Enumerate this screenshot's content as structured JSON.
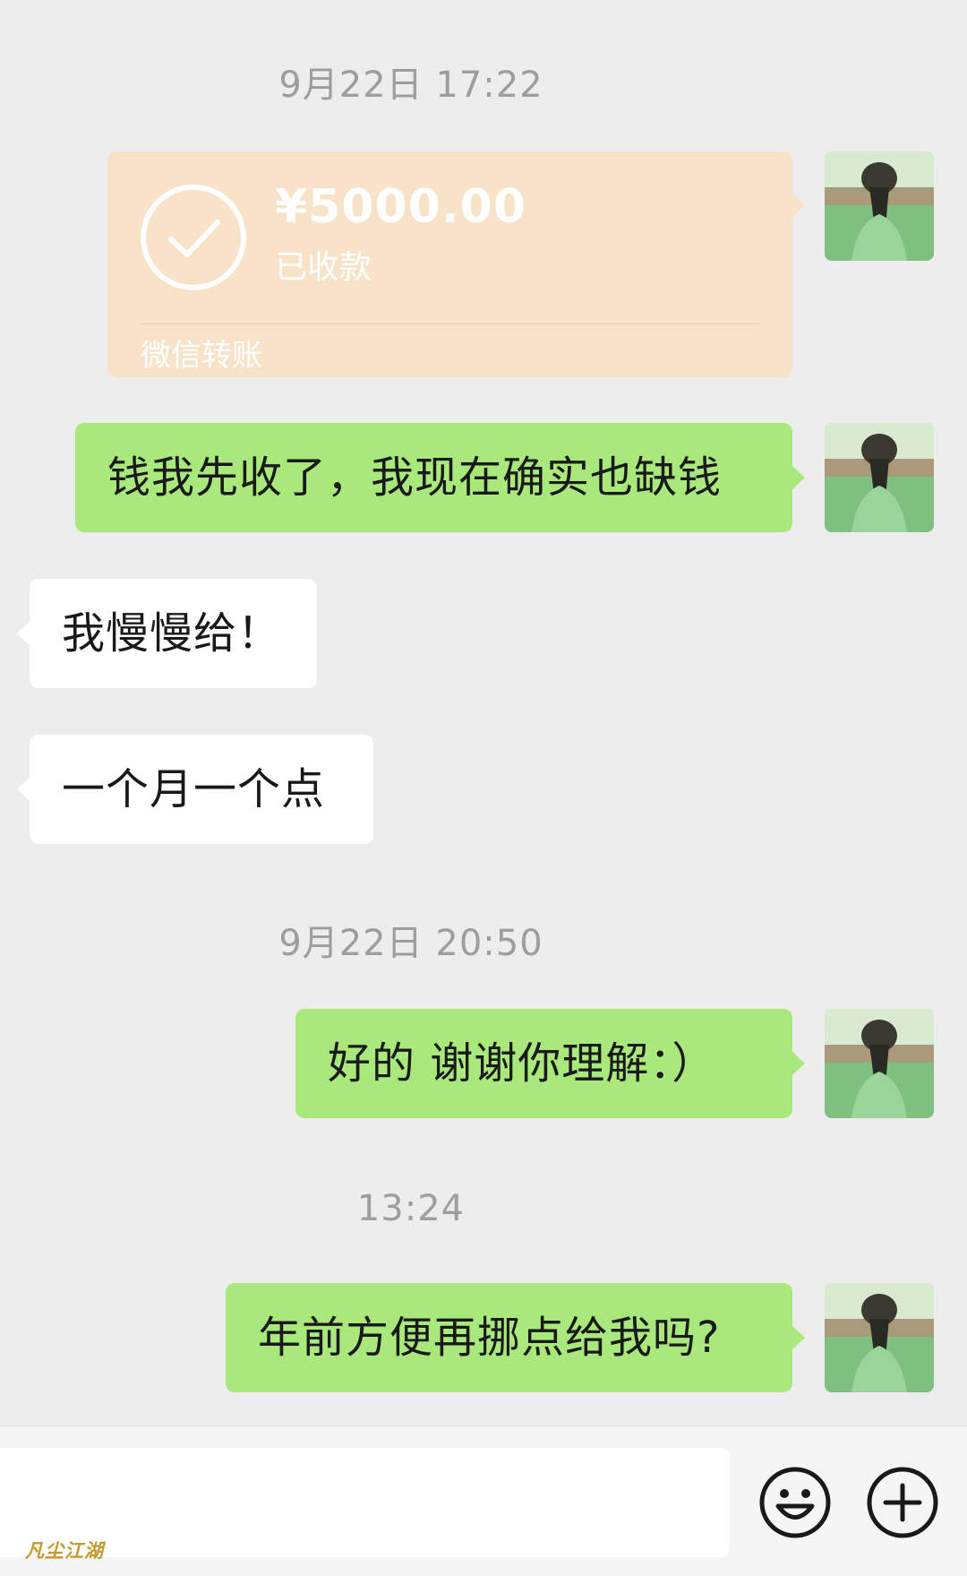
{
  "messages": {
    "timestamp_1": "9月22日 17:22",
    "transfer": {
      "amount": "¥5000.00",
      "status": "已收款",
      "footer": "微信转账"
    },
    "msg_1": "钱我先收了，我现在确实也缺钱",
    "msg_2": "我慢慢给！",
    "msg_3": "一个月一个点",
    "timestamp_2": "9月22日 20:50",
    "msg_4": "好的 谢谢你理解：）",
    "timestamp_3": "13:24",
    "msg_5": "年前方便再挪点给我吗?"
  },
  "input_bar": {
    "text_value": "",
    "emoji_icon": "emoji-icon",
    "plus_icon": "plus-icon"
  },
  "watermark": "凡尘江湖",
  "colors": {
    "background": "#ededed",
    "sent_bubble": "#a9e97b",
    "received_bubble": "#ffffff",
    "transfer_card": "#f8e3c8",
    "timestamp_text": "#9d9d9d"
  }
}
